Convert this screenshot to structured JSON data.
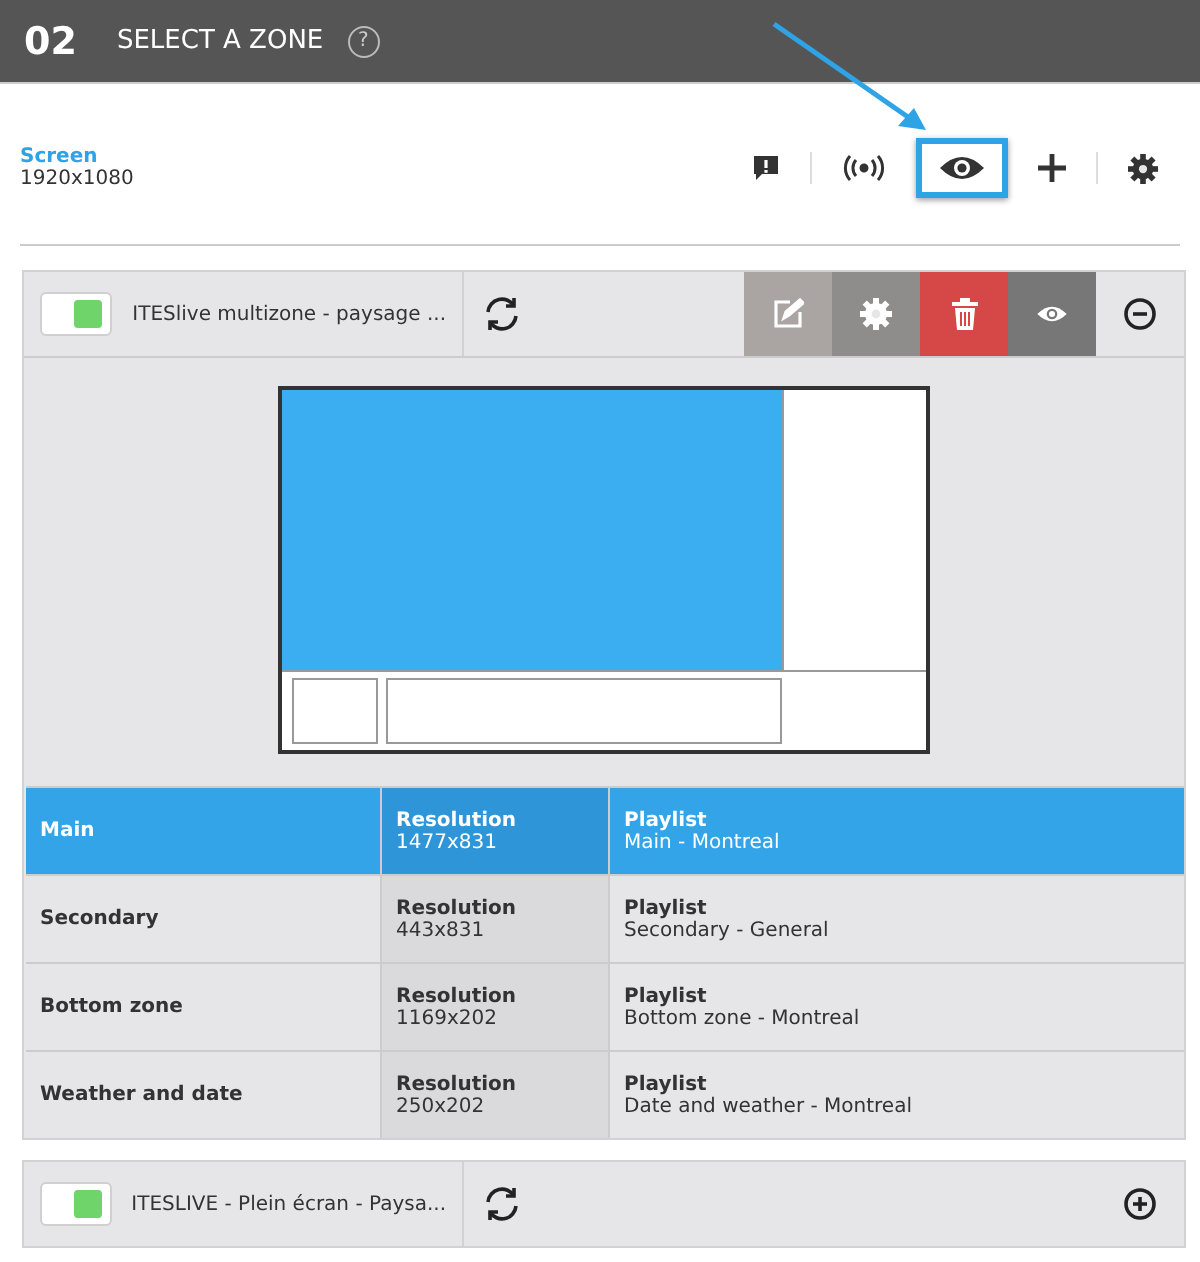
{
  "header": {
    "step": "02",
    "title": "SELECT A ZONE",
    "help": "?"
  },
  "screen": {
    "label": "Screen",
    "resolution": "1920x1080"
  },
  "toolbar": [
    {
      "kind": "alert",
      "highlighted": false
    },
    {
      "kind": "broadcast",
      "highlighted": false
    },
    {
      "kind": "eye",
      "highlighted": true
    },
    {
      "kind": "plus",
      "highlighted": false
    },
    {
      "kind": "gear",
      "highlighted": false
    }
  ],
  "layouts": [
    {
      "name": "ITESlive multizone - paysage ...",
      "on": true,
      "expanded": true,
      "zones": [
        {
          "name": "Main",
          "resolution_label": "Resolution",
          "resolution": "1477x831",
          "playlist_label": "Playlist",
          "playlist": "Main - Montreal",
          "selected": true
        },
        {
          "name": "Secondary",
          "resolution_label": "Resolution",
          "resolution": "443x831",
          "playlist_label": "Playlist",
          "playlist": "Secondary - General",
          "selected": false
        },
        {
          "name": "Bottom zone",
          "resolution_label": "Resolution",
          "resolution": "1169x202",
          "playlist_label": "Playlist",
          "playlist": "Bottom zone - Montreal",
          "selected": false
        },
        {
          "name": "Weather and date",
          "resolution_label": "Resolution",
          "resolution": "250x202",
          "playlist_label": "Playlist",
          "playlist": "Date and weather - Montreal",
          "selected": false
        }
      ]
    },
    {
      "name": "ITESLIVE - Plein écran - Paysa...",
      "on": true,
      "expanded": false
    }
  ]
}
